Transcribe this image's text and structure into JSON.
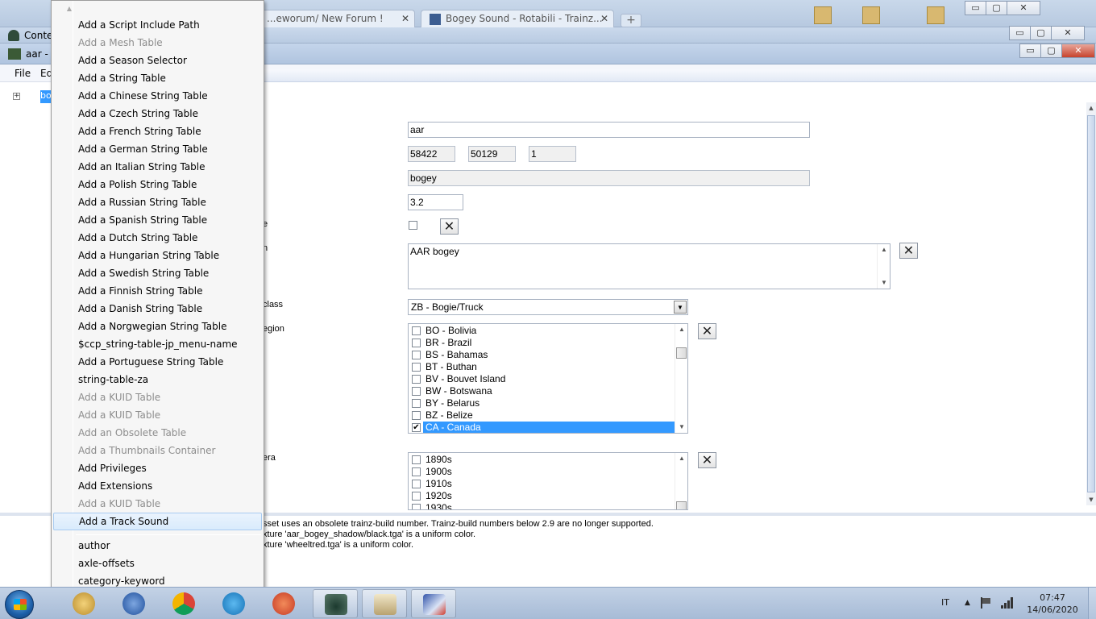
{
  "browser": {
    "tabs": [
      {
        "label": "...eworum/ New Forum !"
      },
      {
        "label": "Bogey Sound - Rotabili - Trainz..."
      }
    ],
    "new_tab": "+"
  },
  "content_manager": {
    "title": "Conte"
  },
  "editor": {
    "title": "aar - ",
    "menu": {
      "file": "File",
      "edit": "Ed"
    },
    "tree_selected": "bo",
    "tree_expander": "+"
  },
  "properties": {
    "labels": {
      "obsolete": "e",
      "description": "n",
      "category_class": "class",
      "category_region": "egion",
      "category_era": "era"
    },
    "username": "aar",
    "kuid": {
      "a": "58422",
      "b": "50129",
      "c": "1"
    },
    "kind": "bogey",
    "trainz_build": "3.2",
    "description": "AAR bogey",
    "category_class": "ZB - Bogie/Truck",
    "regions": [
      {
        "label": "BO - Bolivia",
        "checked": false
      },
      {
        "label": "BR - Brazil",
        "checked": false
      },
      {
        "label": "BS - Bahamas",
        "checked": false
      },
      {
        "label": "BT - Buthan",
        "checked": false
      },
      {
        "label": "BV - Bouvet Island",
        "checked": false
      },
      {
        "label": "BW - Botswana",
        "checked": false
      },
      {
        "label": "BY - Belarus",
        "checked": false
      },
      {
        "label": "BZ - Belize",
        "checked": false
      },
      {
        "label": "CA - Canada",
        "checked": true,
        "selected": true
      }
    ],
    "eras": [
      {
        "label": "1890s",
        "checked": false
      },
      {
        "label": "1900s",
        "checked": false
      },
      {
        "label": "1910s",
        "checked": false
      },
      {
        "label": "1920s",
        "checked": false
      },
      {
        "label": "1930s",
        "checked": false
      }
    ]
  },
  "messages": [
    "sset uses an obsolete trainz-build number. Trainz-build numbers below 2.9 are no longer supported.",
    "xture 'aar_bogey_shadow/black.tga' is a uniform color.",
    "xture 'wheeltred.tga' is a uniform color."
  ],
  "context_menu": {
    "items": [
      {
        "label": "Add a Script Include Path",
        "enabled": true
      },
      {
        "label": "Add a Mesh Table",
        "enabled": false
      },
      {
        "label": "Add a Season Selector",
        "enabled": true
      },
      {
        "label": "Add a String Table",
        "enabled": true
      },
      {
        "label": "Add a Chinese String Table",
        "enabled": true
      },
      {
        "label": "Add a Czech String Table",
        "enabled": true
      },
      {
        "label": "Add a French String Table",
        "enabled": true
      },
      {
        "label": "Add a German String Table",
        "enabled": true
      },
      {
        "label": "Add an Italian String Table",
        "enabled": true
      },
      {
        "label": "Add a Polish String Table",
        "enabled": true
      },
      {
        "label": "Add a Russian String Table",
        "enabled": true
      },
      {
        "label": "Add a Spanish String Table",
        "enabled": true
      },
      {
        "label": "Add a Dutch String Table",
        "enabled": true
      },
      {
        "label": "Add a Hungarian String Table",
        "enabled": true
      },
      {
        "label": "Add a Swedish String Table",
        "enabled": true
      },
      {
        "label": "Add a Finnish String Table",
        "enabled": true
      },
      {
        "label": "Add a Danish String Table",
        "enabled": true
      },
      {
        "label": "Add a Norgwegian String Table",
        "enabled": true
      },
      {
        "label": "$ccp_string-table-jp_menu-name",
        "enabled": true
      },
      {
        "label": "Add a Portuguese String Table",
        "enabled": true
      },
      {
        "label": "string-table-za",
        "enabled": true
      },
      {
        "label": "Add a KUID Table",
        "enabled": false
      },
      {
        "label": "Add a KUID Table",
        "enabled": false
      },
      {
        "label": "Add an Obsolete Table",
        "enabled": false
      },
      {
        "label": "Add a Thumbnails Container",
        "enabled": false
      },
      {
        "label": "Add Privileges",
        "enabled": true
      },
      {
        "label": "Add Extensions",
        "enabled": true
      },
      {
        "label": "Add a KUID Table",
        "enabled": false
      },
      {
        "label": "Add a Track Sound",
        "enabled": true,
        "highlighted": true
      },
      {
        "label": "author",
        "enabled": true
      },
      {
        "label": "axle-offsets",
        "enabled": true
      },
      {
        "label": "category-keyword",
        "enabled": true
      }
    ]
  },
  "window_buttons": {
    "minimize": "▭",
    "maximize": "▢",
    "close": "✕"
  },
  "taskbar": {
    "language": "IT",
    "time": "07:47",
    "date": "14/06/2020"
  },
  "colors": {
    "selection": "#3399ff",
    "menu_highlight": "#d9ebfc",
    "taskbar": "#b7c9e0"
  }
}
